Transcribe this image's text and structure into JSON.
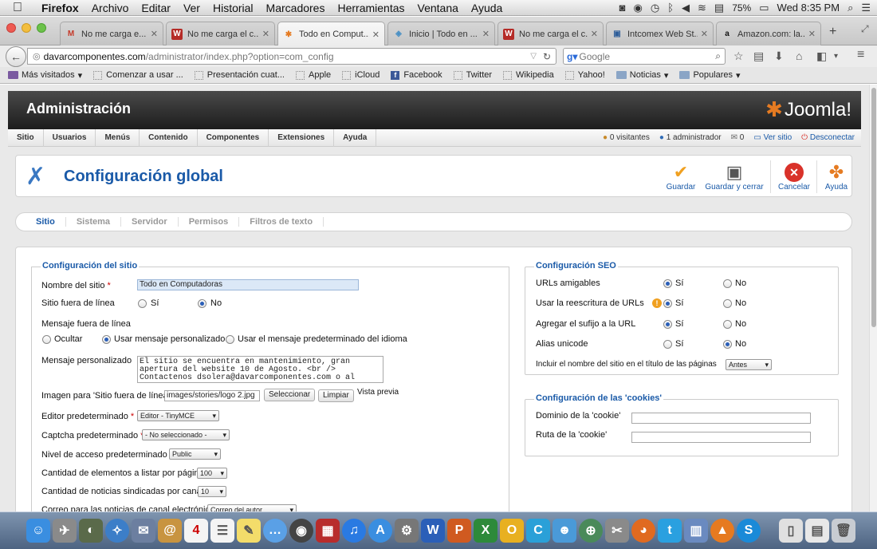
{
  "menubar": {
    "app": "Firefox",
    "items": [
      "Archivo",
      "Editar",
      "Ver",
      "Historial",
      "Marcadores",
      "Herramientas",
      "Ventana",
      "Ayuda"
    ],
    "battery": "75%",
    "clock": "Wed 8:35 PM"
  },
  "tabs": [
    {
      "label": "No me carga e..."
    },
    {
      "label": "No me carga el c..."
    },
    {
      "label": "Todo en Comput..."
    },
    {
      "label": "Inicio | Todo en ..."
    },
    {
      "label": "No me carga el c..."
    },
    {
      "label": "Intcomex Web St..."
    },
    {
      "label": "Amazon.com: la..."
    }
  ],
  "nav": {
    "url_domain": "davarcomponentes.com",
    "url_path": "/administrator/index.php?option=com_config",
    "search_placeholder": "Google"
  },
  "bookmarks": [
    "Más visitados",
    "Comenzar a usar ...",
    "Presentación cuat...",
    "Apple",
    "iCloud",
    "Facebook",
    "Twitter",
    "Wikipedia",
    "Yahoo!",
    "Noticias",
    "Populares"
  ],
  "joomla": {
    "header_title": "Administración",
    "logo_text": "Joomla!",
    "menu": [
      "Sitio",
      "Usuarios",
      "Menús",
      "Contenido",
      "Componentes",
      "Extensiones",
      "Ayuda"
    ],
    "status": {
      "visitors": "0 visitantes",
      "admins": "1 administrador",
      "messages": "0",
      "view_site": "Ver sitio",
      "logout": "Desconectar"
    }
  },
  "toolbar": {
    "title": "Configuración global",
    "save": "Guardar",
    "save_close": "Guardar y cerrar",
    "cancel": "Cancelar",
    "help": "Ayuda"
  },
  "subtabs": [
    "Sitio",
    "Sistema",
    "Servidor",
    "Permisos",
    "Filtros de texto"
  ],
  "site": {
    "legend": "Configuración del sitio",
    "site_name_label": "Nombre del sitio",
    "site_name_value": "Todo en Computadoras",
    "offline_label": "Sitio fuera de línea",
    "yes": "Sí",
    "no": "No",
    "offline_message_label": "Mensaje fuera de línea",
    "hide": "Ocultar",
    "use_custom": "Usar mensaje personalizado",
    "use_default": "Usar el mensaje predeterminado del idioma",
    "custom_message_label": "Mensaje personalizado",
    "custom_message_value": "El sitio se encuentra en mantenimiento, gran apertura del website 10 de Agosto. <br /> Contactenos dsolera@davarcomponentes.com o al",
    "offline_image_label": "Imagen para 'Sitio fuera de línea'",
    "offline_image_value": "images/stories/logo 2.jpg",
    "select_btn": "Seleccionar",
    "clear_btn": "Limpiar",
    "preview": "Vista previa",
    "editor_label": "Editor predeterminado",
    "editor_value": "Editor - TinyMCE",
    "captcha_label": "Captcha predeterminado",
    "captcha_value": "- No seleccionado -",
    "access_label": "Nivel de acceso predeterminado",
    "access_value": "Public",
    "list_limit_label": "Cantidad de elementos a listar por página",
    "list_limit_value": "100",
    "feed_limit_label": "Cantidad de noticias sindicadas por canal",
    "feed_limit_value": "10",
    "feed_email_label": "Correo para las noticias de canal electrónico",
    "feed_email_value": "Correo del autor"
  },
  "seo": {
    "legend": "Configuración SEO",
    "sef_label": "URLs amigables",
    "rewrite_label": "Usar la reescritura de URLs",
    "suffix_label": "Agregar el sufijo a la URL",
    "unicode_label": "Alias unicode",
    "sitename_label": "Incluir el nombre del sitio en el título de las páginas",
    "sitename_value": "Antes",
    "yes": "Sí",
    "no": "No"
  },
  "cookies": {
    "legend": "Configuración de las 'cookies'",
    "domain_label": "Dominio de la 'cookie'",
    "path_label": "Ruta de la 'cookie'"
  },
  "colors": {
    "joomla_blue": "#1a5aa8",
    "cancel_red": "#d9322a",
    "save_orange": "#f0a020"
  }
}
